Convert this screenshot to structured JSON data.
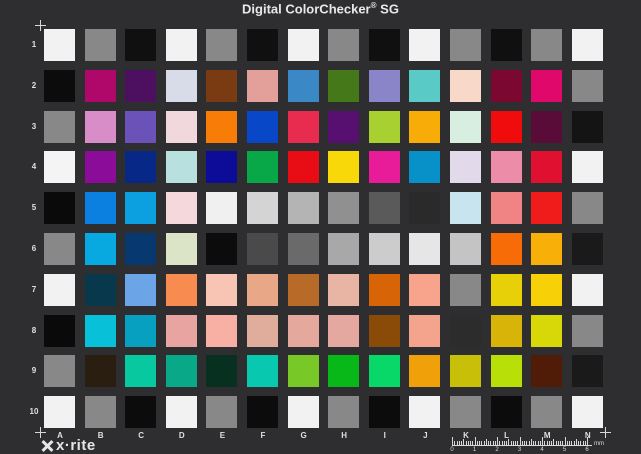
{
  "title": "Digital ColorChecker",
  "title_mark": "®",
  "title_suffix": "SG",
  "brand": "x·rite",
  "ruler": {
    "unit": "mm",
    "numbers": [
      "0",
      "1",
      "2",
      "3",
      "4",
      "5",
      "6"
    ]
  },
  "columns": [
    "A",
    "B",
    "C",
    "D",
    "E",
    "F",
    "G",
    "H",
    "I",
    "J",
    "K",
    "L",
    "M",
    "N"
  ],
  "rows": [
    "1",
    "2",
    "3",
    "4",
    "5",
    "6",
    "7",
    "8",
    "9",
    "10"
  ],
  "patch_colors": [
    [
      "#f2f2f2",
      "#888888",
      "#101010",
      "#f2f2f2",
      "#888888",
      "#101010",
      "#f2f2f2",
      "#888888",
      "#101010",
      "#f2f2f2",
      "#888888",
      "#101010",
      "#888888",
      "#f2f2f2"
    ],
    [
      "#0c0c0c",
      "#b0086a",
      "#4d1060",
      "#d8dce8",
      "#7a3a12",
      "#e3a09a",
      "#3a88c6",
      "#447818",
      "#8a84c8",
      "#5acac6",
      "#f8d8c8",
      "#7a0830",
      "#e0086a",
      "#888888"
    ],
    [
      "#888888",
      "#d88cc8",
      "#6a52b8",
      "#f0d8dc",
      "#f87c08",
      "#0848c8",
      "#e82c50",
      "#581070",
      "#a8d030",
      "#f8ac08",
      "#d8eee0",
      "#f00c0c",
      "#5a0c38",
      "#141414"
    ],
    [
      "#f4f4f4",
      "#8a0c98",
      "#082888",
      "#b8e0de",
      "#0c0c98",
      "#08a848",
      "#e80c14",
      "#f8d808",
      "#e81c98",
      "#0890c8",
      "#e2daea",
      "#ec8ca8",
      "#e01030",
      "#f2f2f2"
    ],
    [
      "#0a0a0a",
      "#0c80e0",
      "#0ca0e0",
      "#f4d8dc",
      "#f0f0f0",
      "#d4d4d4",
      "#b4b4b4",
      "#909090",
      "#5a5a5a",
      "#2a2a2a",
      "#c8e4ee",
      "#f08484",
      "#f01c1c",
      "#888888"
    ],
    [
      "#888888",
      "#08a8e0",
      "#083870",
      "#dce4c8",
      "#0c0c0c",
      "#4a4a4a",
      "#6a6a6a",
      "#a8a8a8",
      "#cccccc",
      "#e6e6e6",
      "#c4c4c4",
      "#f86c08",
      "#f8b008",
      "#1a1a1a"
    ],
    [
      "#f2f2f2",
      "#08384c",
      "#6ca4e8",
      "#f88c50",
      "#f8c4b4",
      "#e8a888",
      "#b86a28",
      "#e8b4a4",
      "#d86408",
      "#f8a48c",
      "#888888",
      "#e8d008",
      "#f8d008",
      "#f2f2f2"
    ],
    [
      "#0a0a0a",
      "#08c0d8",
      "#08a0c0",
      "#e8a4a0",
      "#f8b0a4",
      "#e0ac9c",
      "#e4a89c",
      "#e4a8a0",
      "#8a4a08",
      "#f4a48c",
      "#2c2c2c",
      "#d8b408",
      "#d8d808",
      "#888888"
    ],
    [
      "#888888",
      "#2a1e10",
      "#08c8a0",
      "#08a888",
      "#083020",
      "#08c8b0",
      "#78c828",
      "#08b818",
      "#08d868",
      "#f0a008",
      "#c8c008",
      "#b8e008",
      "#501c08",
      "#1a1a1a"
    ],
    [
      "#f2f2f2",
      "#888888",
      "#0c0c0c",
      "#f2f2f2",
      "#888888",
      "#0c0c0c",
      "#f2f2f2",
      "#888888",
      "#0c0c0c",
      "#f2f2f2",
      "#888888",
      "#0c0c0c",
      "#888888",
      "#f2f2f2"
    ]
  ]
}
